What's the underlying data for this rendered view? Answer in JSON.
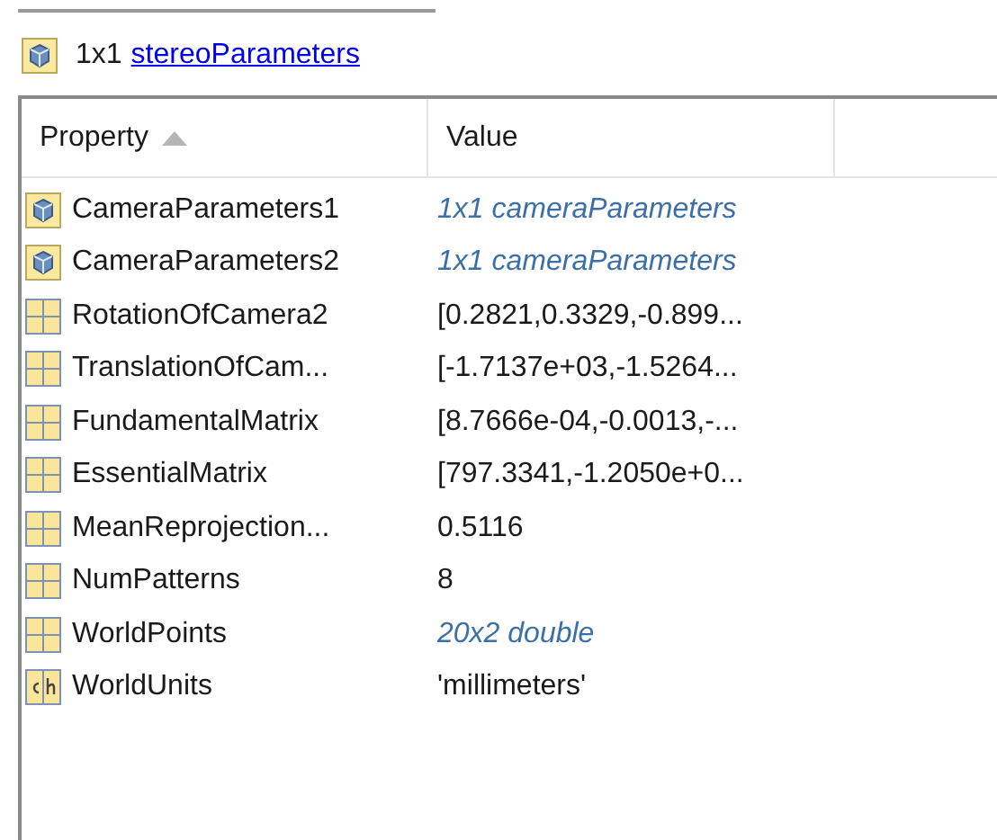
{
  "header": {
    "size": "1x1",
    "class_link": "stereoParameters"
  },
  "table": {
    "columns": [
      {
        "label": "Property",
        "sorted": true
      },
      {
        "label": "Value",
        "sorted": false
      }
    ],
    "rows": [
      {
        "kind": "object",
        "property": "CameraParameters1",
        "value": "1x1 cameraParameters"
      },
      {
        "kind": "object",
        "property": "CameraParameters2",
        "value": "1x1 cameraParameters"
      },
      {
        "kind": "matrix",
        "property": "RotationOfCamera2",
        "value": "[0.2821,0.3329,-0.899..."
      },
      {
        "kind": "matrix",
        "property": "TranslationOfCam...",
        "value": "[-1.7137e+03,-1.5264..."
      },
      {
        "kind": "matrix",
        "property": "FundamentalMatrix",
        "value": "[8.7666e-04,-0.0013,-..."
      },
      {
        "kind": "matrix",
        "property": "EssentialMatrix",
        "value": "[797.3341,-1.2050e+0..."
      },
      {
        "kind": "matrix",
        "property": "MeanReprojection...",
        "value": "0.5116"
      },
      {
        "kind": "matrix",
        "property": "NumPatterns",
        "value": "8"
      },
      {
        "kind": "array",
        "property": "WorldPoints",
        "value": "20x2 double"
      },
      {
        "kind": "char",
        "property": "WorldUnits",
        "value": "'millimeters'"
      }
    ]
  }
}
